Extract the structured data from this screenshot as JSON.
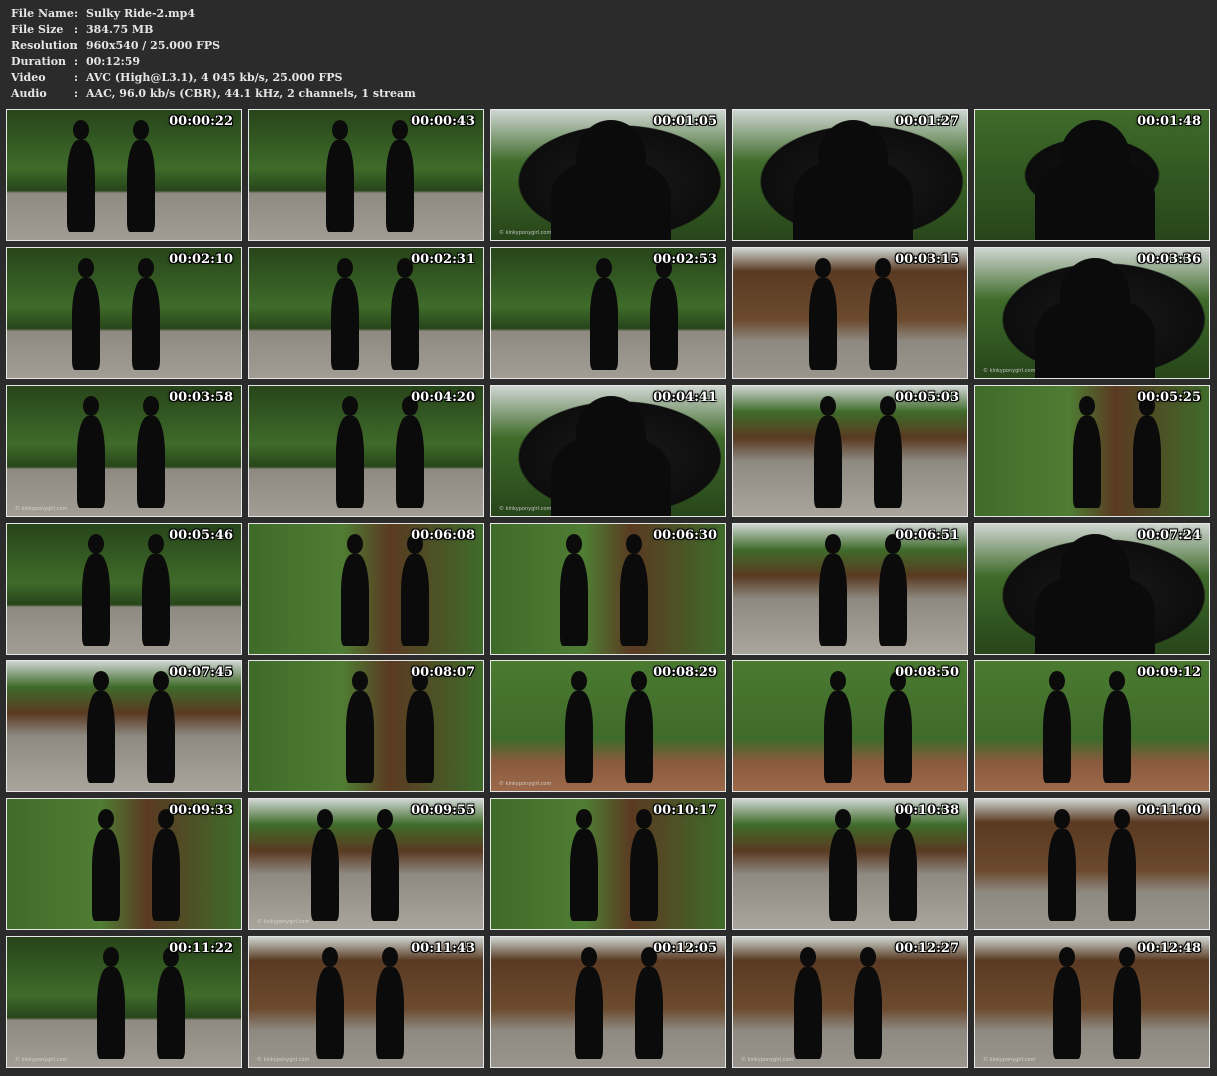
{
  "info": [
    {
      "key": "File Name",
      "value": "Sulky Ride-2.mp4"
    },
    {
      "key": "File Size",
      "value": "384.75 MB"
    },
    {
      "key": "Resolution",
      "value": "960x540 / 25.000 FPS"
    },
    {
      "key": "Duration",
      "value": "00:12:59"
    },
    {
      "key": "Video",
      "value": "AVC (High@L3.1), 4 045 kb/s, 25.000 FPS"
    },
    {
      "key": "Audio",
      "value": "AAC, 96.0 kb/s (CBR), 44.1 kHz, 2 channels, 1 stream"
    }
  ],
  "separator": ":",
  "thumbnails": [
    {
      "time": "00:00:22",
      "scene": "garden-bench",
      "watermark": ""
    },
    {
      "time": "00:00:43",
      "scene": "garden-bench",
      "watermark": ""
    },
    {
      "time": "00:01:05",
      "scene": "closeup-dark",
      "watermark": "© kinkyponygirl.com"
    },
    {
      "time": "00:01:27",
      "scene": "closeup-dark",
      "watermark": ""
    },
    {
      "time": "00:01:48",
      "scene": "closeup-garden",
      "watermark": ""
    },
    {
      "time": "00:02:10",
      "scene": "garden-bench",
      "watermark": ""
    },
    {
      "time": "00:02:31",
      "scene": "garden-bench",
      "watermark": ""
    },
    {
      "time": "00:02:53",
      "scene": "garden-bench",
      "watermark": ""
    },
    {
      "time": "00:03:15",
      "scene": "barn",
      "watermark": ""
    },
    {
      "time": "00:03:36",
      "scene": "closeup-dark",
      "watermark": "© kinkyponygirl.com"
    },
    {
      "time": "00:03:58",
      "scene": "garden-bench",
      "watermark": "© kinkyponygirl.com"
    },
    {
      "time": "00:04:20",
      "scene": "garden-bench",
      "watermark": ""
    },
    {
      "time": "00:04:41",
      "scene": "closeup-dark",
      "watermark": "© kinkyponygirl.com"
    },
    {
      "time": "00:05:03",
      "scene": "courtyard",
      "watermark": ""
    },
    {
      "time": "00:05:25",
      "scene": "ivy-courtyard",
      "watermark": ""
    },
    {
      "time": "00:05:46",
      "scene": "garden-bench",
      "watermark": ""
    },
    {
      "time": "00:06:08",
      "scene": "ivy-courtyard",
      "watermark": ""
    },
    {
      "time": "00:06:30",
      "scene": "ivy-courtyard",
      "watermark": ""
    },
    {
      "time": "00:06:51",
      "scene": "courtyard",
      "watermark": ""
    },
    {
      "time": "00:07:24",
      "scene": "closeup-dark",
      "watermark": ""
    },
    {
      "time": "00:07:45",
      "scene": "courtyard",
      "watermark": ""
    },
    {
      "time": "00:08:07",
      "scene": "ivy-courtyard",
      "watermark": ""
    },
    {
      "time": "00:08:29",
      "scene": "ivy-wall",
      "watermark": "© kinkyponygirl.com"
    },
    {
      "time": "00:08:50",
      "scene": "ivy-wall",
      "watermark": ""
    },
    {
      "time": "00:09:12",
      "scene": "ivy-wall",
      "watermark": ""
    },
    {
      "time": "00:09:33",
      "scene": "ivy-courtyard",
      "watermark": ""
    },
    {
      "time": "00:09:55",
      "scene": "courtyard",
      "watermark": "© kinkyponygirl.com"
    },
    {
      "time": "00:10:17",
      "scene": "ivy-courtyard",
      "watermark": ""
    },
    {
      "time": "00:10:38",
      "scene": "courtyard",
      "watermark": ""
    },
    {
      "time": "00:11:00",
      "scene": "barn",
      "watermark": ""
    },
    {
      "time": "00:11:22",
      "scene": "garden-bench",
      "watermark": "© kinkyponygirl.com"
    },
    {
      "time": "00:11:43",
      "scene": "barn",
      "watermark": "© kinkyponygirl.com"
    },
    {
      "time": "00:12:05",
      "scene": "barn",
      "watermark": ""
    },
    {
      "time": "00:12:27",
      "scene": "barn",
      "watermark": "© kinkyponygirl.com"
    },
    {
      "time": "00:12:48",
      "scene": "barn",
      "watermark": "© kinkyponygirl.com"
    }
  ],
  "colors": {
    "background": "#2b2b2b",
    "text": "#e6e6e6",
    "border": "#e6e6e6",
    "garden": "#3f6b2a",
    "foliage_dark": "#27451a",
    "pavement": "#8e8a82",
    "wood": "#5a3a22",
    "sky": "#cfd6d2",
    "latex": "#0b0b0b"
  }
}
